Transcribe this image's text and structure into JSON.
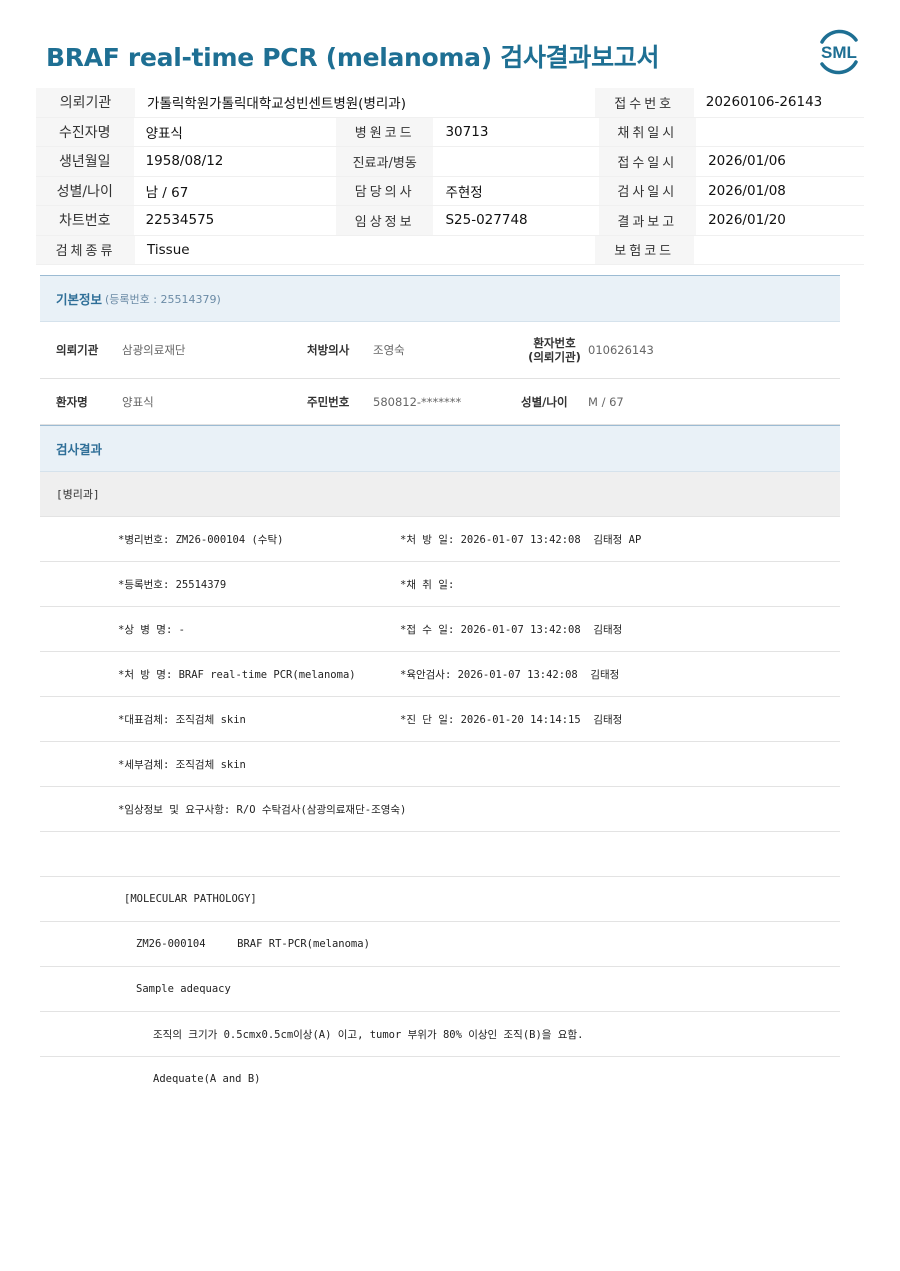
{
  "title": "BRAF real-time PCR (melanoma) 검사결과보고서",
  "logo_text": "SML",
  "brand_color": "#1e6f93",
  "header": {
    "rows": [
      {
        "l1": "의뢰기관",
        "v1": "가톨릭학원가톨릭대학교성빈센트병원(병리과)",
        "l2": "",
        "v2": "",
        "l3": "접수번호",
        "v3": "20260106-26143"
      },
      {
        "l1": "수진자명",
        "v1": "양표식",
        "l2": "병원코드",
        "v2": "30713",
        "l3": "채취일시",
        "v3": ""
      },
      {
        "l1": "생년월일",
        "v1": "1958/08/12",
        "l2": "진료과/병동",
        "v2": "",
        "l3": "접수일시",
        "v3": "2026/01/06"
      },
      {
        "l1": "성별/나이",
        "v1": "남 / 67",
        "l2": "담당의사",
        "v2": "주현정",
        "l3": "검사일시",
        "v3": "2026/01/08"
      },
      {
        "l1": "차트번호",
        "v1": "22534575",
        "l2": "임상정보",
        "v2": "S25-027748",
        "l3": "결과보고",
        "v3": "2026/01/20"
      },
      {
        "l1": "검체종류",
        "v1": "Tissue",
        "l2": "",
        "v2": "",
        "l3": "보험코드",
        "v3": ""
      }
    ]
  },
  "basic": {
    "title": "기본정보",
    "subtitle": "(등록번호 : 25514379)",
    "row1": {
      "l1": "의뢰기관",
      "v1": "삼광의료재단",
      "l2": "처방의사",
      "v2": "조영숙",
      "l3a": "환자번호",
      "l3b": "(의뢰기관)",
      "v3": "010626143"
    },
    "row2": {
      "l1": "환자명",
      "v1": "양표식",
      "l2": "주민번호",
      "v2": "580812-*******",
      "l3": "성별/나이",
      "v3": "M / 67"
    }
  },
  "results": {
    "title": "검사결과",
    "dept": "[병리과]",
    "lines": [
      {
        "left": "*병리번호: ZM26-000104 (수탁)",
        "right": "*처 방 일: 2026-01-07 13:42:08  김태정 AP"
      },
      {
        "left": "*등록번호: 25514379",
        "right": "*채 취 일:"
      },
      {
        "left": "*상 병 명: -",
        "right": "*접 수 일: 2026-01-07 13:42:08  김태정"
      },
      {
        "left": "*처 방 명: BRAF real-time PCR(melanoma)",
        "right": "*육안검사: 2026-01-07 13:42:08  김태정"
      },
      {
        "left": "*대표검체: 조직검체 skin",
        "right": "*진 단 일: 2026-01-20 14:14:15  김태정"
      },
      {
        "left": "*세부검체: 조직검체 skin",
        "right": ""
      },
      {
        "left": "*임상정보 및 요구사항: R/O 수탁검사(삼광의료재단-조영숙)",
        "right": ""
      }
    ],
    "molecular_header": "[MOLECULAR PATHOLOGY]",
    "specimen_line": "ZM26-000104     BRAF RT-PCR(melanoma)",
    "adequacy_title": "Sample adequacy",
    "adequacy_criteria": "조직의 크기가 0.5cmx0.5cm이상(A) 이고, tumor 부위가 80% 이상인 조직(B)을 요함.",
    "adequacy_result": "Adequate(A and B)"
  }
}
